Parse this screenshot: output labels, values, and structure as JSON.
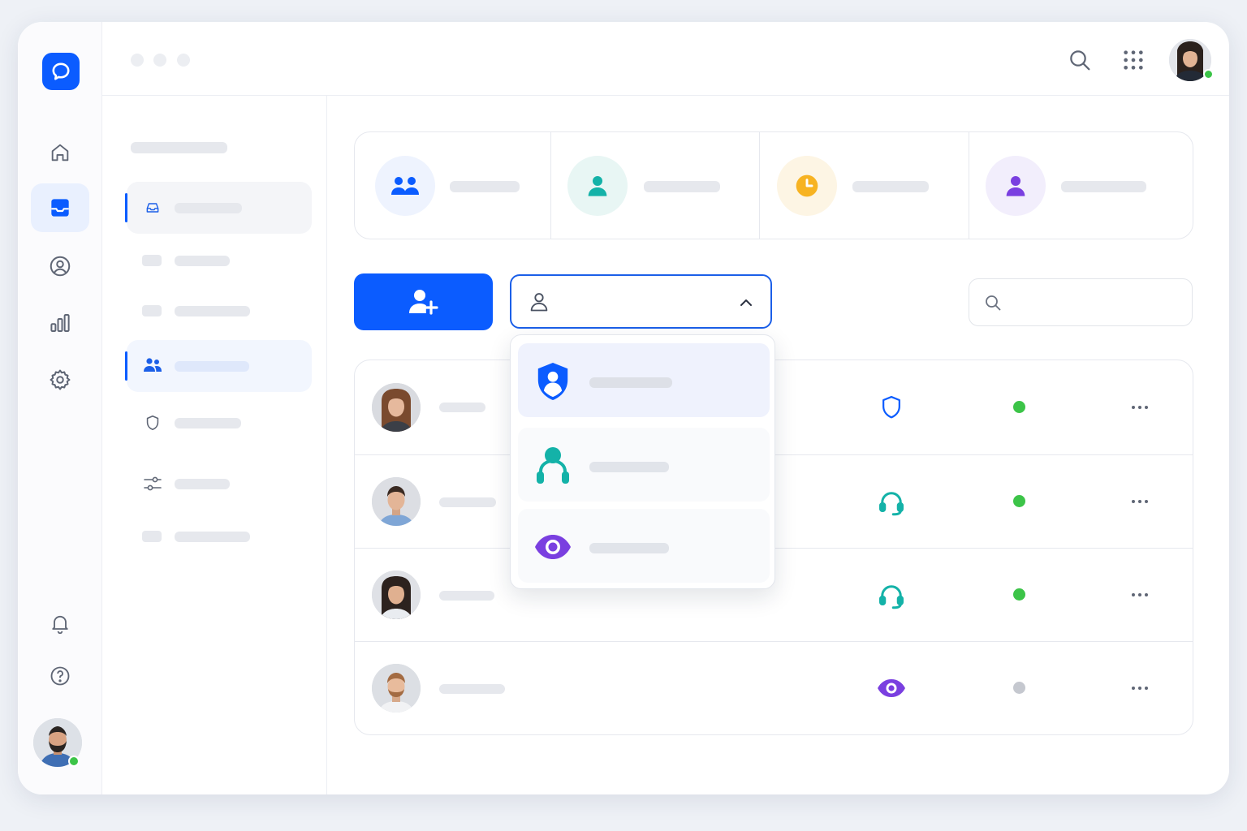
{
  "colors": {
    "accent": "#0b5cff",
    "teal": "#14b2a8",
    "amber": "#f7b322",
    "purple": "#7a3fe0",
    "online": "#3cc448",
    "offline": "#c5c8cf"
  },
  "rail": {
    "logo_icon": "chat-bubble-icon",
    "items": [
      {
        "icon": "home-icon",
        "active": false
      },
      {
        "icon": "inbox-icon",
        "active": true
      },
      {
        "icon": "user-circle-icon",
        "active": false
      },
      {
        "icon": "bar-chart-icon",
        "active": false
      },
      {
        "icon": "gear-icon",
        "active": false
      }
    ],
    "bottom": [
      "bell-icon",
      "help-icon"
    ],
    "user_status": "online"
  },
  "topbar": {
    "icons": [
      "search-icon",
      "apps-grid-icon"
    ],
    "user_status": "online"
  },
  "nav": {
    "items": [
      {
        "icon": "inbox-icon",
        "state": "selected"
      },
      {
        "icon": "placeholder-icon",
        "state": "normal"
      },
      {
        "icon": "placeholder-icon",
        "state": "normal"
      },
      {
        "icon": "users-icon",
        "state": "active"
      },
      {
        "icon": "shield-icon",
        "state": "normal"
      },
      {
        "icon": "sliders-icon",
        "state": "normal"
      },
      {
        "icon": "placeholder-icon",
        "state": "normal"
      }
    ]
  },
  "stats": [
    {
      "icon": "users-icon",
      "color": "#0b5cff",
      "bg": "#eef3fe"
    },
    {
      "icon": "user-icon",
      "color": "#14b2a8",
      "bg": "#e8f6f4"
    },
    {
      "icon": "clock-icon",
      "color": "#f7b322",
      "bg": "#fdf5e4"
    },
    {
      "icon": "user-icon",
      "color": "#7a3fe0",
      "bg": "#f2eefc"
    }
  ],
  "toolbar": {
    "add_button_icon": "user-plus-icon",
    "role_select_icon": "user-icon",
    "role_select_state": "open",
    "search_icon": "search-icon"
  },
  "role_options": [
    {
      "icon": "shield-user-icon",
      "color": "#0b5cff",
      "highlighted": true
    },
    {
      "icon": "agent-icon",
      "color": "#14b2a8",
      "highlighted": false
    },
    {
      "icon": "eye-icon",
      "color": "#7a3fe0",
      "highlighted": false
    }
  ],
  "members": [
    {
      "role_icon": "shield-icon",
      "role_color": "#0b5cff",
      "status": "online"
    },
    {
      "role_icon": "headset-icon",
      "role_color": "#14b2a8",
      "status": "online"
    },
    {
      "role_icon": "headset-icon",
      "role_color": "#14b2a8",
      "status": "online"
    },
    {
      "role_icon": "eye-icon",
      "role_color": "#7a3fe0",
      "status": "offline"
    }
  ]
}
